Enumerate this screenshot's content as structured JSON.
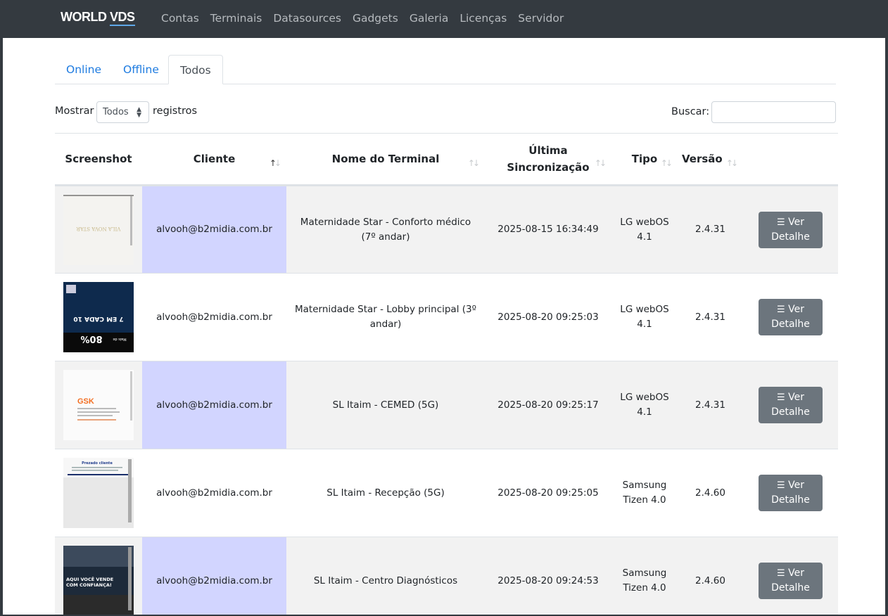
{
  "brand": {
    "part1": "WORLD",
    "part2": "VDS"
  },
  "nav": [
    "Contas",
    "Terminais",
    "Datasources",
    "Gadgets",
    "Galeria",
    "Licenças",
    "Servidor"
  ],
  "tabs": [
    "Online",
    "Offline",
    "Todos"
  ],
  "controls": {
    "show_label": "Mostrar",
    "show_value": "Todos",
    "records_label": "registros",
    "search_label": "Buscar:",
    "search_value": ""
  },
  "table": {
    "headers": {
      "screenshot": "Screenshot",
      "client": "Cliente",
      "terminal": "Nome do Terminal",
      "sync_line1": "Última",
      "sync_line2": "Sincronização",
      "type": "Tipo",
      "version": "Versão"
    },
    "button_icon": "list-icon",
    "button_label_line1": "Ver",
    "button_label_line2": "Detalhe",
    "rows": [
      {
        "client": "alvooh@b2midia.com.br",
        "terminal": "Maternidade Star - Conforto médico (7º andar)",
        "sync": "2025-08-15 16:34:49",
        "type": "LG webOS 4.1",
        "version": "2.4.31"
      },
      {
        "client": "alvooh@b2midia.com.br",
        "terminal": "Maternidade Star - Lobby principal (3º andar)",
        "sync": "2025-08-20 09:25:03",
        "type": "LG webOS 4.1",
        "version": "2.4.31"
      },
      {
        "client": "alvooh@b2midia.com.br",
        "terminal": "SL Itaim - CEMED (5G)",
        "sync": "2025-08-20 09:25:17",
        "type": "LG webOS 4.1",
        "version": "2.4.31"
      },
      {
        "client": "alvooh@b2midia.com.br",
        "terminal": "SL Itaim - Recepção (5G)",
        "sync": "2025-08-20 09:25:05",
        "type": "Samsung Tizen 4.0",
        "version": "2.4.60"
      },
      {
        "client": "alvooh@b2midia.com.br",
        "terminal": "SL Itaim - Centro Diagnósticos",
        "sync": "2025-08-20 09:24:53",
        "type": "Samsung Tizen 4.0",
        "version": "2.4.60"
      }
    ]
  },
  "thumbnail_texts": {
    "row1": "VILA NOVA STAR",
    "row2_a": "Mais de",
    "row2_b": "80%",
    "row2_c": "7 EM CADA 10",
    "row3": "GSK",
    "row4": "Prezado cliente",
    "row5_a": "AQUI VOCÊ VENDE",
    "row5_b": "COM CONFIANÇA!"
  }
}
